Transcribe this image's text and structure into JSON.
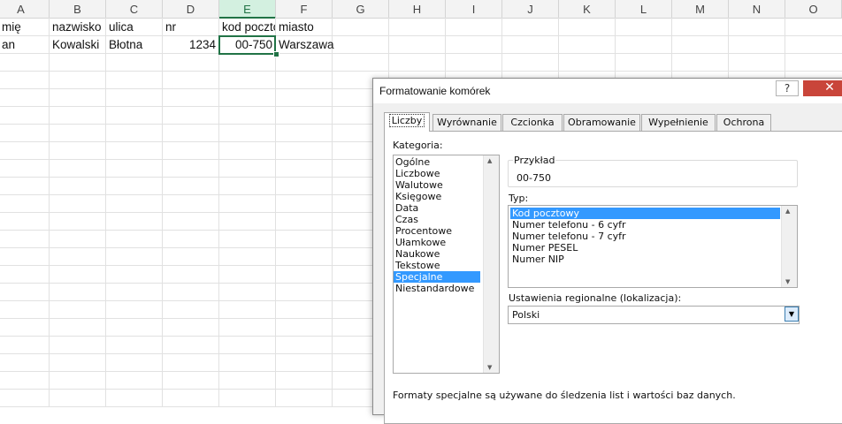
{
  "columns": [
    "A",
    "B",
    "C",
    "D",
    "E",
    "F",
    "G",
    "H",
    "I",
    "J",
    "K",
    "L",
    "M",
    "N",
    "O"
  ],
  "selected_column": "E",
  "rows": [
    [
      "mię",
      "nazwisko",
      "ulica",
      "nr",
      "kod pocztowy",
      "miasto"
    ],
    [
      "an",
      "Kowalski",
      "Błotna",
      "1234",
      "00-750",
      "Warszawa"
    ]
  ],
  "dialog": {
    "title": "Formatowanie komórek",
    "help_label": "?",
    "close_label": "✕",
    "tabs": [
      "Liczby",
      "Wyrównanie",
      "Czcionka",
      "Obramowanie",
      "Wypełnienie",
      "Ochrona"
    ],
    "active_tab": "Liczby",
    "category_label": "Kategoria:",
    "categories": [
      "Ogólne",
      "Liczbowe",
      "Walutowe",
      "Księgowe",
      "Data",
      "Czas",
      "Procentowe",
      "Ułamkowe",
      "Naukowe",
      "Tekstowe",
      "Specjalne",
      "Niestandardowe"
    ],
    "selected_category": "Specjalne",
    "sample_label": "Przykład",
    "sample_value": "00-750",
    "type_label": "Typ:",
    "types": [
      "Kod pocztowy",
      "Numer telefonu - 6 cyfr",
      "Numer telefonu - 7 cyfr",
      "Numer PESEL",
      "Numer NIP"
    ],
    "selected_type": "Kod pocztowy",
    "locale_label": "Ustawienia regionalne (lokalizacja):",
    "locale_value": "Polski",
    "description": "Formaty specjalne są używane do śledzenia list i wartości baz danych."
  }
}
